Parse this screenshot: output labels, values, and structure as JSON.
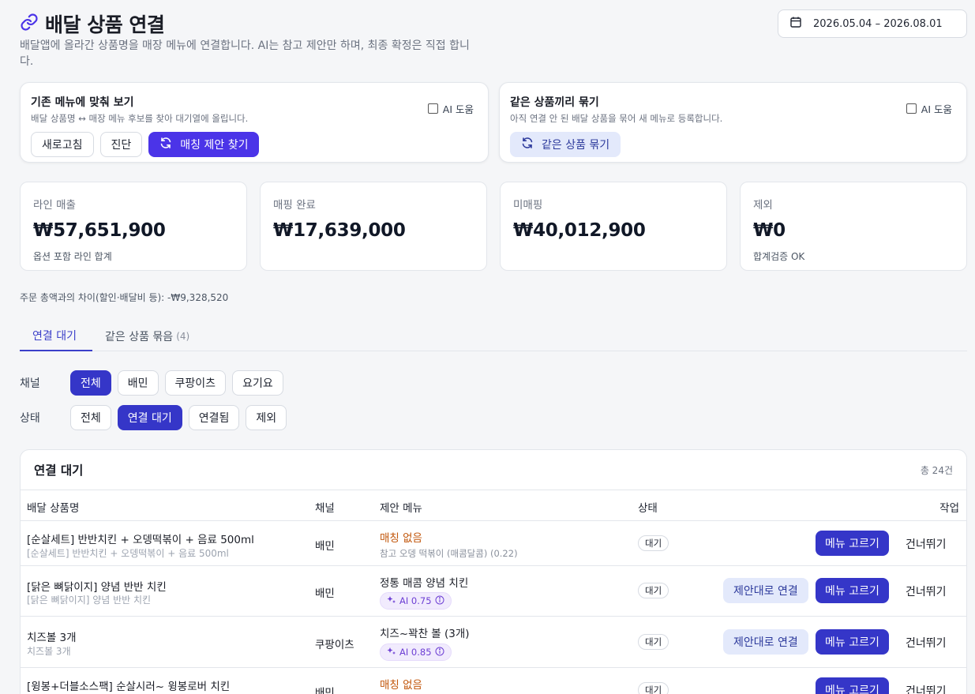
{
  "header": {
    "title": "배달 상품 연결",
    "description": "배달앱에 올라간 상품명을 매장 메뉴에 연결합니다. AI는 참고 제안만 하며, 최종 확정은 직접 합니다.",
    "date_range": "2026.05.04 – 2026.08.01"
  },
  "panels": {
    "match": {
      "title": "기존 메뉴에 맞춰 보기",
      "subtitle": "배달 상품명 ↔ 매장 메뉴 후보를 찾아 대기열에 올립니다.",
      "ai_label": "AI 도움",
      "refresh_label": "새로고침",
      "diagnose_label": "진단",
      "find_label": "매칭 제안 찾기"
    },
    "group": {
      "title": "같은 상품끼리 묶기",
      "subtitle": "아직 연결 안 된 배달 상품을 묶어 새 메뉴로 등록합니다.",
      "ai_label": "AI 도움",
      "group_label": "같은 상품 묶기"
    }
  },
  "stats": [
    {
      "label": "라인 매출",
      "value": "₩57,651,900",
      "note": "옵션 포함 라인 합계"
    },
    {
      "label": "매핑 완료",
      "value": "₩17,639,000",
      "note": ""
    },
    {
      "label": "미매핑",
      "value": "₩40,012,900",
      "note": ""
    },
    {
      "label": "제외",
      "value": "₩0",
      "note": "합계검증 OK"
    }
  ],
  "diff_note": "주문 총액과의 차이(할인·배달비 등): -₩9,328,520",
  "tabs": [
    {
      "label": "연결 대기",
      "count": ""
    },
    {
      "label": "같은 상품 묶음",
      "count": "(4)"
    }
  ],
  "filters": {
    "channel_label": "채널",
    "channels": [
      "전체",
      "배민",
      "쿠팡이츠",
      "요기요"
    ],
    "status_label": "상태",
    "statuses": [
      "전체",
      "연결 대기",
      "연결됨",
      "제외"
    ]
  },
  "table": {
    "title": "연결 대기",
    "total": "총 24건",
    "columns": {
      "name": "배달 상품명",
      "channel": "채널",
      "suggestion": "제안 메뉴",
      "status": "상태",
      "action": "작업"
    },
    "accept_label": "제안대로 연결",
    "pick_label": "메뉴 고르기",
    "skip_label": "건너뛰기",
    "rows": [
      {
        "name": "[순살세트] 반반치킨 + 오뎅떡볶이 + 음료 500ml",
        "sub": "[순살세트] 반반치킨 + 오뎅떡볶이 + 음료 500ml",
        "channel": "배민",
        "suggestion": "매칭 없음",
        "hint": "참고 오뎅 떡볶이 (매콤달콤) (0.22)",
        "status": "대기"
      },
      {
        "name": "[닭은 뼈닭이지] 양념 반반 치킨",
        "sub": "[닭은 뼈닭이지] 양념 반반 치킨",
        "channel": "배민",
        "suggestion": "정통 매콤 양념 치킨",
        "ai": "AI 0.75",
        "status": "대기"
      },
      {
        "name": "치즈볼 3개",
        "sub": "치즈볼 3개",
        "channel": "쿠팡이츠",
        "suggestion": "치즈~꽉찬 볼 (3개)",
        "ai": "AI 0.85",
        "status": "대기"
      },
      {
        "name": "[윙봉+더블소스팩] 순살시러~ 윙봉로버 치킨",
        "sub": "",
        "channel": "배민",
        "suggestion": "매칭 없음",
        "status": "대기"
      }
    ]
  }
}
